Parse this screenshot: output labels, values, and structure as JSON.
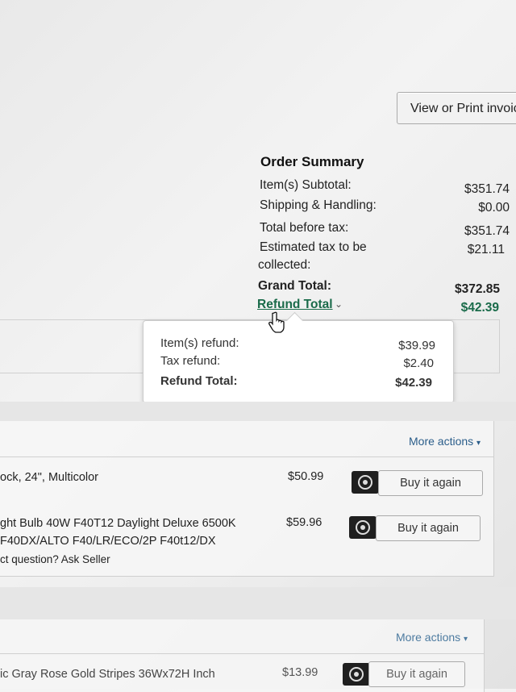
{
  "invoice": {
    "label": "View or Print invoice"
  },
  "order_summary": {
    "title": "Order Summary",
    "rows": [
      {
        "label": "Item(s) Subtotal:",
        "value": "$351.74"
      },
      {
        "label": "Shipping & Handling:",
        "value": "$0.00"
      },
      {
        "label": "Total before tax:",
        "value": "$351.74"
      },
      {
        "label": "Estimated tax to be",
        "label2": "collected:",
        "value": "$21.11"
      }
    ],
    "grand_total": {
      "label": "Grand Total:",
      "value": "$372.85"
    },
    "refund_total": {
      "label": "Refund Total",
      "value": "$42.39"
    }
  },
  "refund_popover": {
    "items_refund": {
      "label": "Item(s) refund:",
      "value": "$39.99"
    },
    "tax_refund": {
      "label": "Tax refund:",
      "value": "$2.40"
    },
    "refund_total": {
      "label": "Refund Total:",
      "value": "$42.39"
    }
  },
  "shipment1": {
    "more_actions": "More actions",
    "items": [
      {
        "title": "ock, 24\", Multicolor",
        "price": "$50.99",
        "buy_label": "Buy it again"
      },
      {
        "title": "ght Bulb 40W F40T12 Daylight Deluxe 6500K",
        "line2": "F40DX/ALTO F40/LR/ECO/2P F40t12/DX",
        "line3": "ct question? Ask Seller",
        "price": "$59.96",
        "buy_label": "Buy it again"
      }
    ]
  },
  "shipment2": {
    "more_actions": "More actions",
    "items": [
      {
        "title": "ic Gray Rose Gold Stripes 36Wx72H Inch",
        "price": "$13.99",
        "buy_label": "Buy it again"
      }
    ]
  }
}
